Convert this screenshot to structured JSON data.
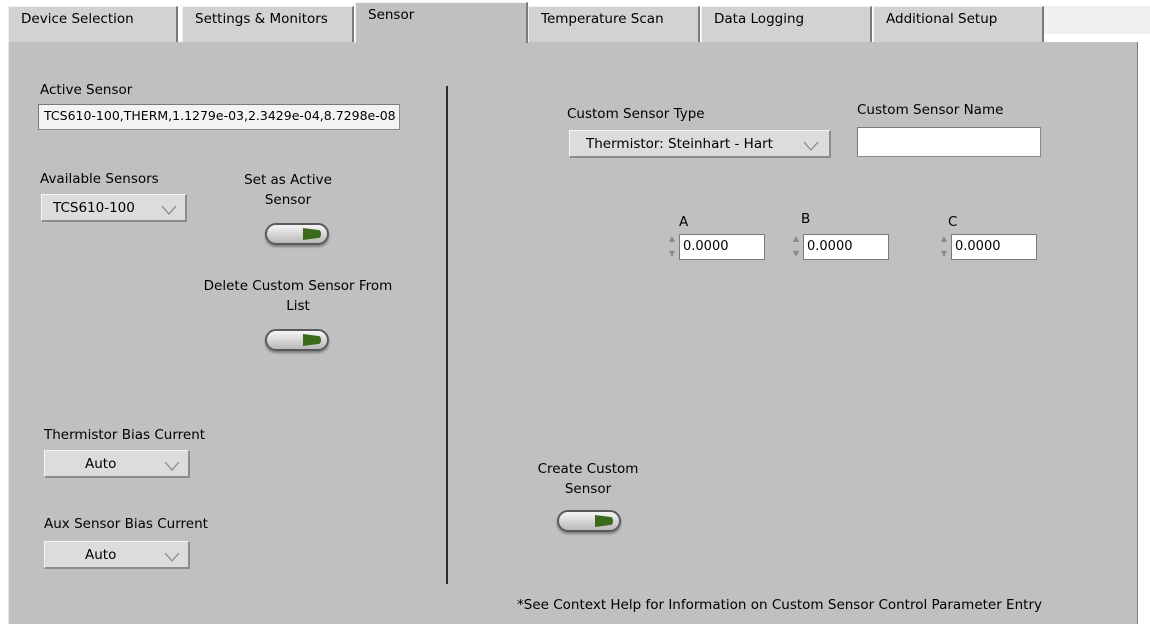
{
  "tabs": [
    {
      "label": "Device Selection",
      "active": false
    },
    {
      "label": "Settings & Monitors",
      "active": false
    },
    {
      "label": "Sensor",
      "active": true
    },
    {
      "label": "Temperature Scan",
      "active": false
    },
    {
      "label": "Data Logging",
      "active": false
    },
    {
      "label": "Additional Setup",
      "active": false
    }
  ],
  "left": {
    "active_sensor_label": "Active Sensor",
    "active_sensor_value": "TCS610-100,THERM,1.1279e-03,2.3429e-04,8.7298e-08",
    "available_sensors_label": "Available Sensors",
    "available_sensors_value": "TCS610-100",
    "set_active_label": "Set as Active Sensor",
    "delete_label": "Delete Custom Sensor From List",
    "thermistor_bias_label": "Thermistor Bias Current",
    "thermistor_bias_value": "Auto",
    "aux_bias_label": "Aux Sensor Bias Current",
    "aux_bias_value": "Auto"
  },
  "right": {
    "custom_type_label": "Custom Sensor Type",
    "custom_type_value": "Thermistor: Steinhart - Hart",
    "custom_name_label": "Custom Sensor Name",
    "custom_name_value": "",
    "coef_a_label": "A",
    "coef_a_value": "0.0000",
    "coef_b_label": "B",
    "coef_b_value": "0.0000",
    "coef_c_label": "C",
    "coef_c_value": "0.0000",
    "create_label": "Create Custom Sensor",
    "help_note": "*See Context Help for Information on Custom Sensor Control Parameter Entry"
  },
  "colors": {
    "panel": "#c0c0c0",
    "led_on": "#3a6a1a"
  }
}
